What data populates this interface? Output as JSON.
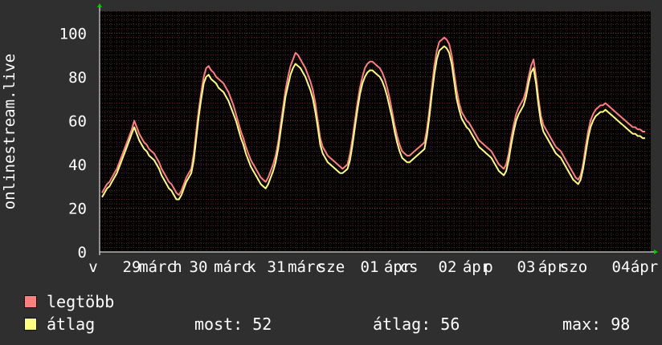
{
  "chart_data": {
    "type": "line",
    "ylabel": "onlinestream.live",
    "ylim": [
      0,
      110
    ],
    "yticks": [
      0,
      20,
      40,
      60,
      80,
      100
    ],
    "x_tick_labels": [
      "v",
      "29",
      "márc",
      "h",
      "30",
      "márc",
      "k",
      "31",
      "márc",
      "sze",
      "01",
      "ápr",
      "cs",
      "02",
      "ápr",
      "p",
      "03",
      "ápr",
      "szo",
      "04",
      "ápr"
    ],
    "grid": true,
    "series": [
      {
        "name": "legtöbb",
        "color": "#ff7f7f",
        "values": [
          27,
          29,
          31,
          32,
          34,
          36,
          38,
          41,
          44,
          47,
          50,
          53,
          56,
          60,
          57,
          54,
          52,
          50,
          49,
          47,
          46,
          45,
          43,
          41,
          38,
          36,
          34,
          32,
          31,
          29,
          27,
          26,
          28,
          31,
          34,
          36,
          38,
          45,
          55,
          65,
          73,
          80,
          84,
          85,
          83,
          82,
          80,
          79,
          78,
          77,
          75,
          73,
          70,
          67,
          63,
          59,
          55,
          52,
          48,
          45,
          42,
          40,
          38,
          36,
          34,
          33,
          32,
          34,
          37,
          40,
          44,
          50,
          58,
          66,
          74,
          80,
          85,
          88,
          91,
          90,
          88,
          86,
          84,
          81,
          78,
          74,
          68,
          60,
          52,
          48,
          46,
          44,
          43,
          42,
          41,
          40,
          39,
          38,
          39,
          40,
          45,
          52,
          60,
          68,
          75,
          80,
          84,
          86,
          87,
          87,
          86,
          85,
          84,
          82,
          79,
          75,
          70,
          64,
          58,
          53,
          49,
          46,
          45,
          44,
          44,
          45,
          46,
          47,
          48,
          49,
          50,
          56,
          65,
          75,
          85,
          92,
          96,
          97,
          98,
          97,
          95,
          90,
          82,
          74,
          68,
          64,
          62,
          60,
          59,
          57,
          55,
          53,
          51,
          50,
          49,
          48,
          47,
          46,
          44,
          42,
          40,
          39,
          38,
          40,
          45,
          52,
          58,
          63,
          66,
          68,
          70,
          74,
          80,
          85,
          88,
          80,
          70,
          62,
          58,
          56,
          54,
          52,
          50,
          48,
          47,
          46,
          44,
          42,
          40,
          38,
          36,
          34,
          33,
          35,
          40,
          48,
          55,
          60,
          63,
          65,
          66,
          67,
          67,
          68,
          67,
          66,
          65,
          64,
          63,
          62,
          61,
          60,
          59,
          58,
          57,
          57,
          56,
          56,
          55,
          55
        ]
      },
      {
        "name": "átlag",
        "color": "#ffff7f",
        "values": [
          25,
          27,
          29,
          30,
          32,
          34,
          36,
          39,
          42,
          45,
          48,
          51,
          54,
          57,
          54,
          51,
          49,
          47,
          46,
          44,
          43,
          42,
          40,
          38,
          35,
          33,
          31,
          29,
          28,
          26,
          24,
          24,
          26,
          29,
          32,
          34,
          36,
          42,
          52,
          62,
          70,
          77,
          80,
          81,
          79,
          78,
          77,
          75,
          74,
          73,
          71,
          69,
          66,
          63,
          60,
          56,
          52,
          49,
          45,
          42,
          39,
          37,
          35,
          33,
          31,
          30,
          29,
          31,
          34,
          37,
          41,
          47,
          55,
          63,
          71,
          76,
          81,
          84,
          86,
          85,
          84,
          82,
          80,
          77,
          74,
          70,
          64,
          57,
          49,
          45,
          43,
          41,
          40,
          39,
          38,
          37,
          36,
          36,
          37,
          38,
          42,
          49,
          57,
          65,
          72,
          77,
          80,
          82,
          83,
          83,
          82,
          81,
          80,
          78,
          75,
          71,
          66,
          61,
          55,
          50,
          46,
          43,
          42,
          41,
          41,
          42,
          43,
          44,
          45,
          46,
          47,
          53,
          62,
          72,
          81,
          88,
          92,
          93,
          94,
          93,
          91,
          86,
          78,
          70,
          65,
          61,
          59,
          57,
          56,
          54,
          52,
          50,
          48,
          47,
          46,
          45,
          44,
          43,
          41,
          39,
          37,
          36,
          35,
          37,
          42,
          49,
          55,
          60,
          63,
          65,
          67,
          71,
          77,
          82,
          84,
          77,
          67,
          59,
          55,
          53,
          51,
          49,
          47,
          45,
          44,
          43,
          41,
          39,
          37,
          35,
          33,
          32,
          31,
          33,
          38,
          45,
          52,
          57,
          60,
          62,
          63,
          64,
          64,
          65,
          64,
          63,
          62,
          61,
          60,
          59,
          58,
          57,
          56,
          55,
          54,
          54,
          53,
          53,
          52,
          52
        ]
      }
    ]
  },
  "legend": [
    {
      "label": "legtöbb",
      "color": "#ff7f7f"
    },
    {
      "label": "átlag",
      "color": "#ffff7f"
    }
  ],
  "stats": {
    "most": "most: 52",
    "avg": "átlag: 56",
    "max": "max: 98"
  }
}
